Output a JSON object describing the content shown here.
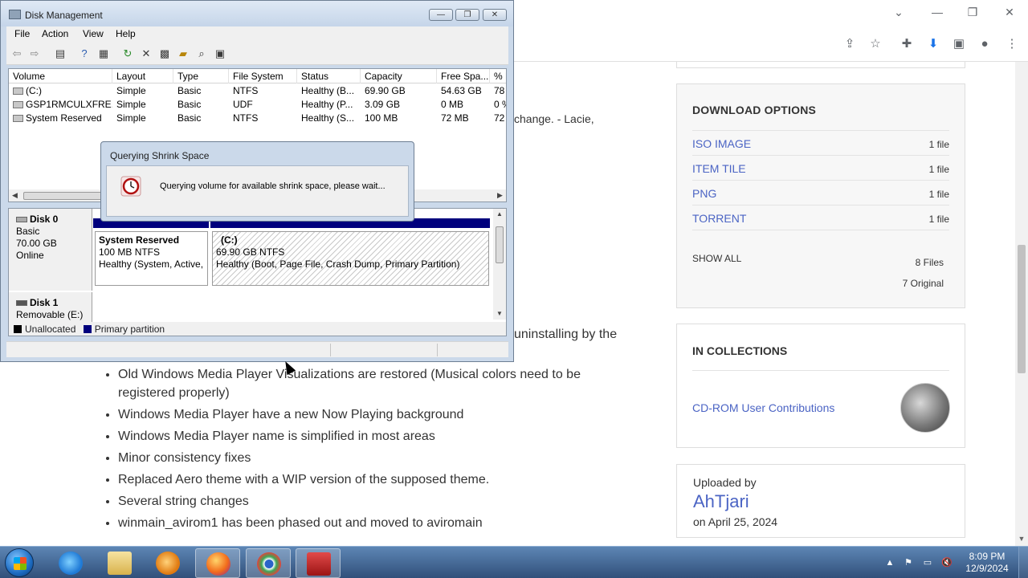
{
  "browser": {
    "title_controls": [
      "⌄",
      "—",
      "❐",
      "✕"
    ],
    "toolbar_icons": [
      "share-icon",
      "star-icon",
      "extensions-icon",
      "download-icon",
      "sidepanel-icon",
      "profile-icon",
      "menu-icon"
    ]
  },
  "page": {
    "fragment_change": "change. - Lacie,",
    "fragment_uninstall": "uninstalling by the",
    "bullets": [
      "Old Windows Media Player Visualizations are restored (Musical colors need to be registered properly)",
      "Windows Media Player have a new Now Playing background",
      "Windows Media Player name is simplified in most areas",
      "Minor consistency fixes",
      "Replaced Aero theme with a WIP version of the supposed theme.",
      "Several string changes",
      "winmain_avirom1 has been phased out and moved to aviromain"
    ]
  },
  "sidebar": {
    "download": {
      "title": "DOWNLOAD OPTIONS",
      "items": [
        {
          "name": "ISO IMAGE",
          "count": "1 file"
        },
        {
          "name": "ITEM TILE",
          "count": "1 file"
        },
        {
          "name": "PNG",
          "count": "1 file"
        },
        {
          "name": "TORRENT",
          "count": "1 file"
        }
      ],
      "show_all": "SHOW ALL",
      "total_files": "8 Files",
      "original": "7 Original"
    },
    "collections": {
      "title": "IN COLLECTIONS",
      "link": "CD-ROM User Contributions"
    },
    "uploaded": {
      "label": "Uploaded by",
      "user": "AhTjari",
      "date": "on April 25, 2024"
    }
  },
  "disk_mgmt": {
    "title": "Disk Management",
    "buttons": {
      "minimize": "—",
      "maximize": "❐",
      "close": "✕"
    },
    "menus": [
      "File",
      "Action",
      "View",
      "Help"
    ],
    "columns": [
      "Volume",
      "Layout",
      "Type",
      "File System",
      "Status",
      "Capacity",
      "Free Spa...",
      "% F"
    ],
    "rows": [
      [
        "(C:)",
        "Simple",
        "Basic",
        "NTFS",
        "Healthy (B...",
        "69.90 GB",
        "54.63 GB",
        "78"
      ],
      [
        "GSP1RMCULXFRE...",
        "Simple",
        "Basic",
        "UDF",
        "Healthy (P...",
        "3.09 GB",
        "0 MB",
        "0 %"
      ],
      [
        "System Reserved",
        "Simple",
        "Basic",
        "NTFS",
        "Healthy (S...",
        "100 MB",
        "72 MB",
        "72"
      ]
    ],
    "disk0": {
      "name": "Disk 0",
      "type": "Basic",
      "size": "70.00 GB",
      "state": "Online",
      "partitions": [
        {
          "name": "System Reserved",
          "size": "100 MB NTFS",
          "status": "Healthy (System, Active,"
        },
        {
          "name": "(C:)",
          "size": "69.90 GB NTFS",
          "status": "Healthy (Boot, Page File, Crash Dump, Primary Partition)"
        }
      ]
    },
    "disk1": {
      "name": "Disk 1",
      "type": "Removable (E:)"
    },
    "legend": {
      "unallocated": "Unallocated",
      "primary": "Primary partition"
    },
    "colors": {
      "unallocated": "#000000",
      "primary": "#00007d"
    }
  },
  "dialog": {
    "title": "Querying Shrink Space",
    "message": "Querying volume for available shrink space, please wait..."
  },
  "taskbar": {
    "apps": [
      "internet-explorer",
      "file-explorer",
      "media-player",
      "firefox",
      "chrome-app",
      "toolbox-app"
    ],
    "clock_time": "8:09 PM",
    "clock_date": "12/9/2024"
  }
}
